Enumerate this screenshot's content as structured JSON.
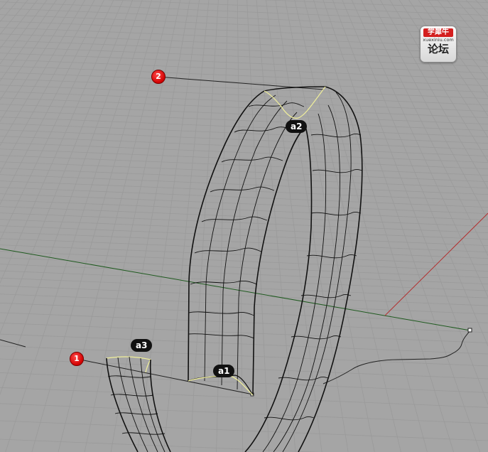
{
  "viewport": {
    "background": "#a5a5a5",
    "grid_color": "#9a9a9a",
    "axis_x_color": "#b23030",
    "axis_y_color": "#1f5a1f",
    "curve_color": "#111111",
    "highlight_color": "#f0ef9a"
  },
  "logo": {
    "top_text": "学犀牛",
    "url_text": "xuexiniu.com",
    "main_text": "论坛"
  },
  "markers": [
    {
      "id": "marker-1",
      "label": "1"
    },
    {
      "id": "marker-2",
      "label": "2"
    }
  ],
  "tags": [
    {
      "id": "tag-a1",
      "label": "a1"
    },
    {
      "id": "tag-a2",
      "label": "a2"
    },
    {
      "id": "tag-a3",
      "label": "a3"
    }
  ]
}
